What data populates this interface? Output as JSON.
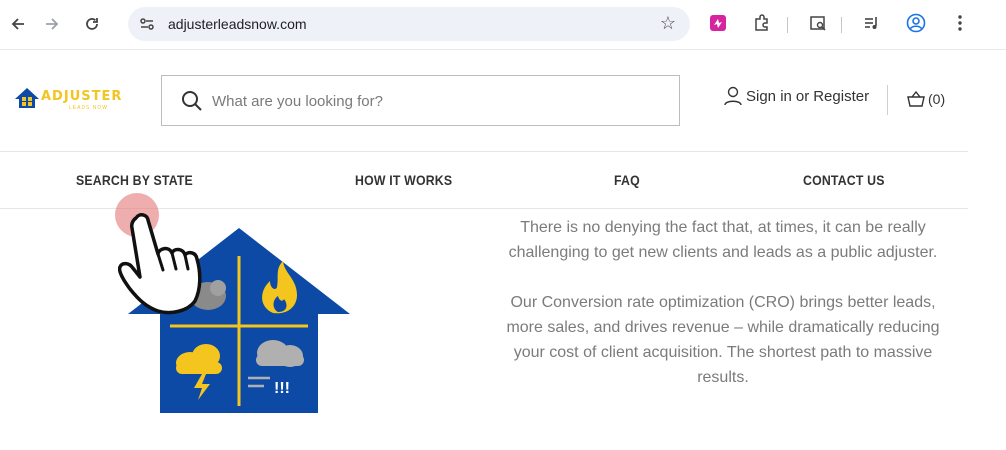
{
  "browser": {
    "url": "adjusterleadsnow.com"
  },
  "header": {
    "logo_text": "ADJUSTER",
    "logo_subtext": "LEADS NOW",
    "search_placeholder": "What are you looking for?",
    "sign_in": "Sign in",
    "or": "or",
    "register": "Register",
    "cart_count": "(0)"
  },
  "nav": {
    "items": [
      {
        "label": "SEARCH BY STATE"
      },
      {
        "label": "HOW IT WORKS"
      },
      {
        "label": "FAQ"
      },
      {
        "label": "CONTACT US"
      }
    ]
  },
  "hero": {
    "paragraph1": "There is no denying the fact that, at times, it can be really challenging to get new clients and leads as a public adjuster.",
    "paragraph2": "Our Conversion rate optimization (CRO) brings better leads, more sales, and drives revenue – while dramatically reducing your cost of client acquisition. The shortest path to massive results.",
    "art_text": "!!!"
  },
  "colors": {
    "brand_blue": "#0c4aa6",
    "brand_yellow": "#f3c51e",
    "text_gray": "#7b7b7b"
  }
}
